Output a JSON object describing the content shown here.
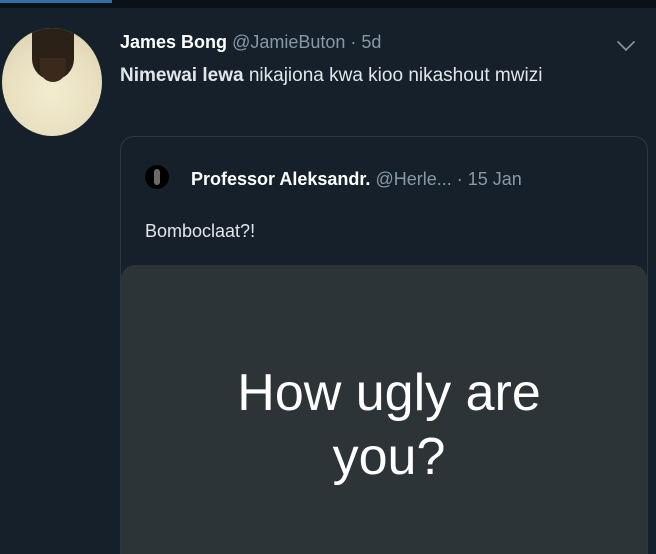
{
  "tweet": {
    "name": "James Bong",
    "handle": "@JamieButon",
    "separator": "·",
    "time": "5d",
    "text_bold": "Nimewai lewa",
    "text_rest": " nikajiona kwa kioo nikashout mwizi"
  },
  "quoted": {
    "name": "Professor Aleksandr.",
    "handle": "@Herle...",
    "separator": "·",
    "time": "15 Jan",
    "text": "Bomboclaat?!",
    "media_line1": "How ugly are",
    "media_line2": "you?"
  },
  "icons": {
    "menu": "chevron-down-icon"
  },
  "colors": {
    "background": "#15202b",
    "secondary_text": "#8899a6",
    "media_background": "#2c3438"
  }
}
